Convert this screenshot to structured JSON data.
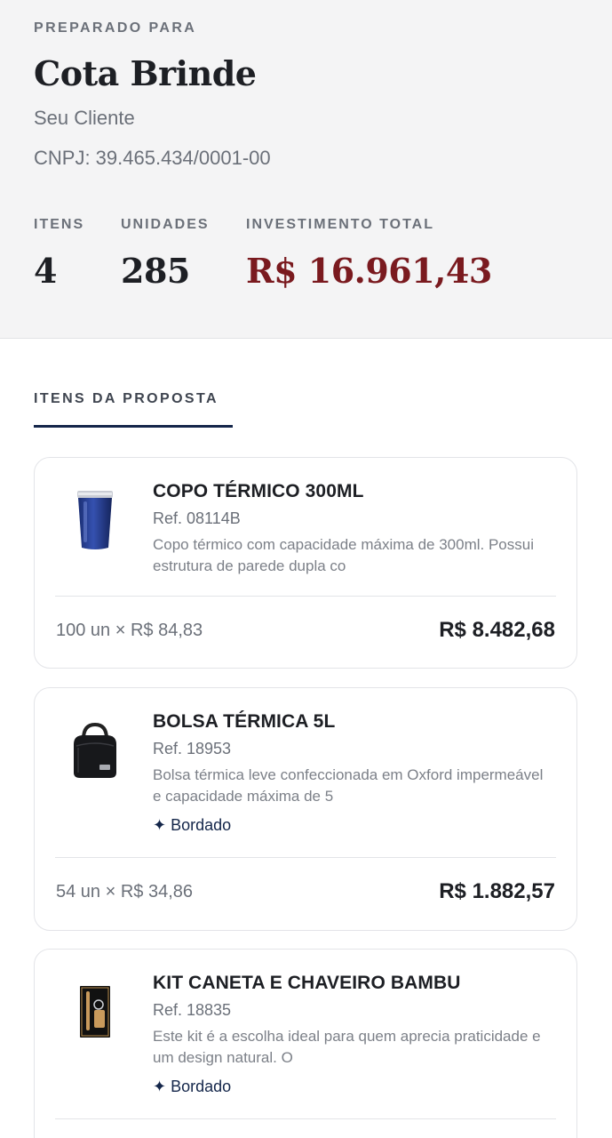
{
  "header": {
    "eyebrow": "PREPARADO PARA",
    "client_name": "Cota Brinde",
    "client_subtitle": "Seu Cliente",
    "cnpj": "CNPJ: 39.465.434/0001-00"
  },
  "stats": {
    "items_label": "ITENS",
    "items_value": "4",
    "units_label": "UNIDADES",
    "units_value": "285",
    "total_label": "INVESTIMENTO TOTAL",
    "total_value": "R$ 16.961,43"
  },
  "section": {
    "title": "ITENS DA PROPOSTA"
  },
  "items": [
    {
      "title": "COPO TÉRMICO 300ML",
      "ref": "Ref. 08114B",
      "desc": "Copo térmico com capacidade máxima de 300ml. Possui estrutura de parede dupla co",
      "tag": "",
      "qty": "100 un × R$ 84,83",
      "total": "R$ 8.482,68",
      "icon": "tumbler-icon"
    },
    {
      "title": "BOLSA TÉRMICA 5L",
      "ref": "Ref. 18953",
      "desc": "Bolsa térmica leve confeccionada em Oxford impermeável e capacidade máxima de 5",
      "tag": "✦ Bordado",
      "qty": "54 un × R$ 34,86",
      "total": "R$ 1.882,57",
      "icon": "cooler-bag-icon"
    },
    {
      "title": "KIT CANETA E CHAVEIRO BAMBU",
      "ref": "Ref. 18835",
      "desc": "Este kit é a escolha ideal para quem aprecia praticidade e um design natural. O",
      "tag": "✦ Bordado",
      "qty": "",
      "total": "",
      "icon": "pen-keychain-kit-icon"
    }
  ],
  "colors": {
    "accent_navy": "#14264a",
    "total_red": "#7a1a1f"
  }
}
